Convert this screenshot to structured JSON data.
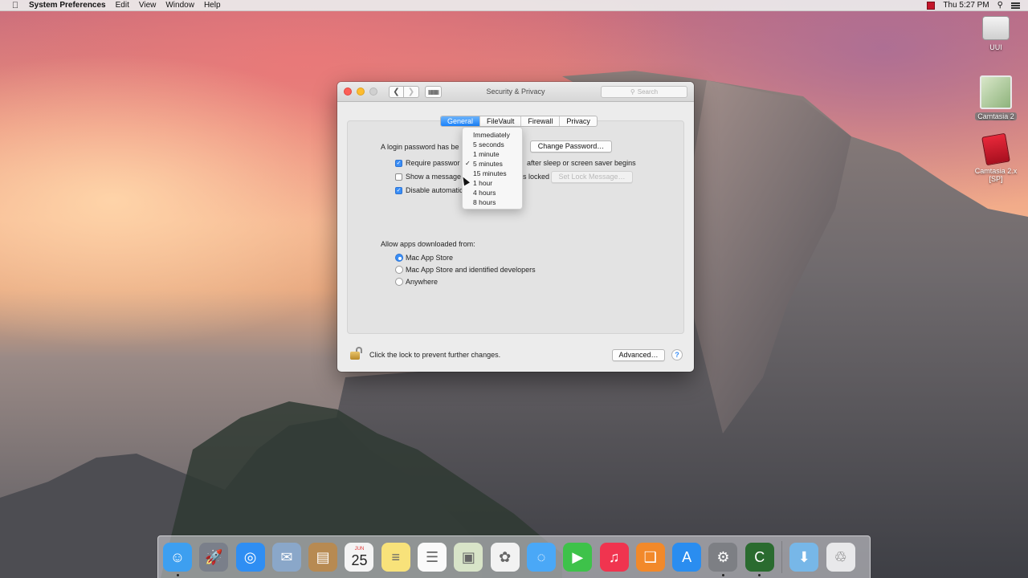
{
  "menubar": {
    "app_name": "System Preferences",
    "items": [
      "Edit",
      "View",
      "Window",
      "Help"
    ],
    "clock": "Thu 5:27 PM"
  },
  "desktop_icons": [
    {
      "label": "UUI"
    },
    {
      "label": "Camtasia 2"
    },
    {
      "label": "Camtasia 2.x [SP]"
    }
  ],
  "window": {
    "title": "Security & Privacy",
    "search_placeholder": "Search",
    "tabs": [
      {
        "label": "General",
        "active": true
      },
      {
        "label": "FileVault",
        "active": false
      },
      {
        "label": "Firewall",
        "active": false
      },
      {
        "label": "Privacy",
        "active": false
      }
    ],
    "login_password_text": "A login password has be",
    "change_password_button": "Change Password…",
    "require_password": {
      "label": "Require passwor",
      "suffix": "after sleep or screen saver begins",
      "checked": true
    },
    "show_message": {
      "label": "Show a message",
      "suffix": "s locked",
      "checked": false
    },
    "set_lock_message_button": "Set Lock Message…",
    "disable_auto_login": {
      "label": "Disable automatic",
      "checked": true
    },
    "delay_popup": {
      "options": [
        "Immediately",
        "5 seconds",
        "1 minute",
        "5 minutes",
        "15 minutes",
        "1 hour",
        "4 hours",
        "8 hours"
      ],
      "selected": "5 minutes",
      "check_glyph": "✓"
    },
    "allow_apps_heading": "Allow apps downloaded from:",
    "allow_apps_options": [
      {
        "label": "Mac App Store",
        "checked": true
      },
      {
        "label": "Mac App Store and identified developers",
        "checked": false
      },
      {
        "label": "Anywhere",
        "checked": false
      }
    ],
    "lock_text": "Click the lock to prevent further changes.",
    "advanced_button": "Advanced…",
    "help_glyph": "?"
  },
  "dock": {
    "icons": [
      {
        "name": "finder-icon",
        "color": "#3d9ff0",
        "running": true
      },
      {
        "name": "launchpad-icon",
        "color": "#7a7f8a",
        "running": false
      },
      {
        "name": "safari-icon",
        "color": "#2f8ef3",
        "running": false
      },
      {
        "name": "mail-icon",
        "color": "#8aa7c9",
        "running": false
      },
      {
        "name": "contacts-icon",
        "color": "#b78a52",
        "running": false
      },
      {
        "name": "calendar-icon",
        "color": "#f4f4f4",
        "running": false,
        "month": "JUN",
        "day": "25"
      },
      {
        "name": "notes-icon",
        "color": "#f8e27a",
        "running": false
      },
      {
        "name": "reminders-icon",
        "color": "#fafafa",
        "running": false
      },
      {
        "name": "preview-icon",
        "color": "#d8e4c8",
        "running": false
      },
      {
        "name": "photos-icon",
        "color": "#f2f2f2",
        "running": false
      },
      {
        "name": "messages-icon",
        "color": "#4aa8f7",
        "running": false
      },
      {
        "name": "facetime-icon",
        "color": "#3ec24a",
        "running": false
      },
      {
        "name": "itunes-icon",
        "color": "#f0344f",
        "running": false
      },
      {
        "name": "ibooks-icon",
        "color": "#f2892a",
        "running": false
      },
      {
        "name": "app-store-icon",
        "color": "#2a8df0",
        "running": false
      },
      {
        "name": "system-preferences-icon",
        "color": "#7d7f84",
        "running": true
      },
      {
        "name": "camtasia-icon",
        "color": "#2a6b2f",
        "running": true
      }
    ],
    "right_icons": [
      {
        "name": "downloads-folder-icon",
        "color": "#77b7e8"
      },
      {
        "name": "trash-icon",
        "color": "#e8e8ea"
      }
    ]
  }
}
